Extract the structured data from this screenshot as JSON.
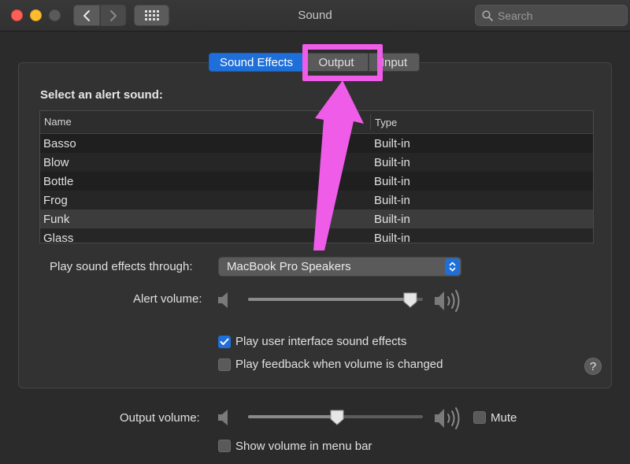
{
  "window": {
    "title": "Sound"
  },
  "toolbar": {
    "search_placeholder": "Search"
  },
  "tabs": [
    {
      "label": "Sound Effects",
      "selected": true
    },
    {
      "label": "Output",
      "selected": false
    },
    {
      "label": "Input",
      "selected": false
    }
  ],
  "alert": {
    "heading": "Select an alert sound:",
    "columns": [
      "Name",
      "Type"
    ],
    "sounds": [
      {
        "name": "Basso",
        "type": "Built-in"
      },
      {
        "name": "Blow",
        "type": "Built-in"
      },
      {
        "name": "Bottle",
        "type": "Built-in"
      },
      {
        "name": "Frog",
        "type": "Built-in"
      },
      {
        "name": "Funk",
        "type": "Built-in",
        "selected": true
      },
      {
        "name": "Glass",
        "type": "Built-in"
      }
    ]
  },
  "play_through": {
    "label": "Play sound effects through:",
    "value": "MacBook Pro Speakers"
  },
  "alert_volume": {
    "label": "Alert volume:",
    "level": 0.93
  },
  "checkboxes": {
    "ui_effects": {
      "label": "Play user interface sound effects",
      "checked": true
    },
    "feedback": {
      "label": "Play feedback when volume is changed",
      "checked": false
    },
    "mute": {
      "label": "Mute",
      "checked": false
    },
    "menu_bar": {
      "label": "Show volume in menu bar",
      "checked": false
    }
  },
  "output_volume": {
    "label": "Output volume:",
    "level": 0.51
  },
  "help_label": "?",
  "colors": {
    "accent": "#1e6fd9",
    "annotation": "#ee5ce8"
  },
  "icons": [
    "back-chevron-icon",
    "forward-chevron-icon",
    "grid-icon",
    "search-icon",
    "speaker-low-icon",
    "speaker-high-icon",
    "checkmark-icon",
    "help-icon",
    "annotation-arrow-icon"
  ]
}
